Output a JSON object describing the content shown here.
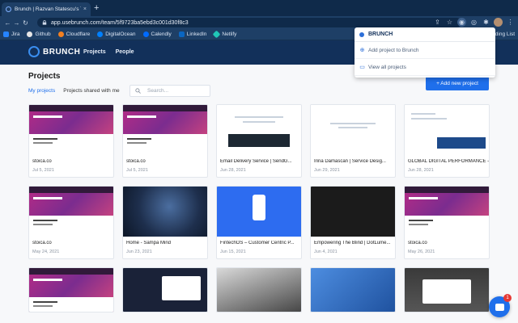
{
  "browser": {
    "tab": {
      "title": "Brunch | Razvan Statescu's Te",
      "close": "×"
    },
    "new_tab": "+",
    "url": "app.usebrunch.com/team/5f9723ba5ebd3c001d30f8c3",
    "reading_list": "Reading List",
    "bookmarks": [
      {
        "label": "Jira",
        "color": "#2684ff"
      },
      {
        "label": "Github",
        "color": "#e6e6e6"
      },
      {
        "label": "Cloudflare",
        "color": "#f38020"
      },
      {
        "label": "DigitalOcean",
        "color": "#0080ff"
      },
      {
        "label": "Calendly",
        "color": "#006bff"
      },
      {
        "label": "LinkedIn",
        "color": "#0a66c2"
      },
      {
        "label": "Netlify",
        "color": "#20c6b7"
      }
    ]
  },
  "app": {
    "logo": "BRUNCH",
    "nav": [
      "Projects",
      "People"
    ]
  },
  "popup": {
    "title": "BRUNCH",
    "items": [
      "Add project to Brunch",
      "View all projects"
    ]
  },
  "main": {
    "title": "Projects",
    "tabs": [
      "My projects",
      "Projects shared with me"
    ],
    "search_placeholder": "Search...",
    "add_button": "+ Add new project"
  },
  "projects": [
    {
      "name": "stoica.co",
      "date": "Jul 5, 2021",
      "thumb": "pink"
    },
    {
      "name": "stoica.co",
      "date": "Jul 5, 2021",
      "thumb": "pink"
    },
    {
      "name": "Email Delivery Service | SendG...",
      "date": "Jun 28, 2021",
      "thumb": "white-dark"
    },
    {
      "name": "Irina Damascan | Service Desig...",
      "date": "Jun 29, 2021",
      "thumb": "white"
    },
    {
      "name": "GLOBAL DIGITAL PERFORMANCE - A...",
      "date": "Jun 28, 2021",
      "thumb": "white-global"
    },
    {
      "name": "stoica.co",
      "date": "May 24, 2021",
      "thumb": "pink"
    },
    {
      "name": "Home - Sampa Mind",
      "date": "Jun 23, 2021",
      "thumb": "ai"
    },
    {
      "name": "FintechOS – Customer Centric P...",
      "date": "Jun 15, 2021",
      "thumb": "blue"
    },
    {
      "name": "Empowering The Blind | DotLume...",
      "date": "Jun 4, 2021",
      "thumb": "black"
    },
    {
      "name": "stoica.co",
      "date": "May 26, 2021",
      "thumb": "pink"
    },
    {
      "name": "",
      "date": "",
      "thumb": "pink"
    },
    {
      "name": "",
      "date": "",
      "thumb": "navy"
    },
    {
      "name": "",
      "date": "",
      "thumb": "photo"
    },
    {
      "name": "",
      "date": "",
      "thumb": "blueimg"
    },
    {
      "name": "",
      "date": "",
      "thumb": "gray"
    }
  ],
  "chat": {
    "badge": "1"
  },
  "icons": {
    "back": "arrow-left-icon",
    "forward": "arrow-right-icon",
    "reload": "reload-icon",
    "lock": "lock-icon",
    "share": "share-icon",
    "star": "star-icon",
    "search": "search-icon"
  }
}
